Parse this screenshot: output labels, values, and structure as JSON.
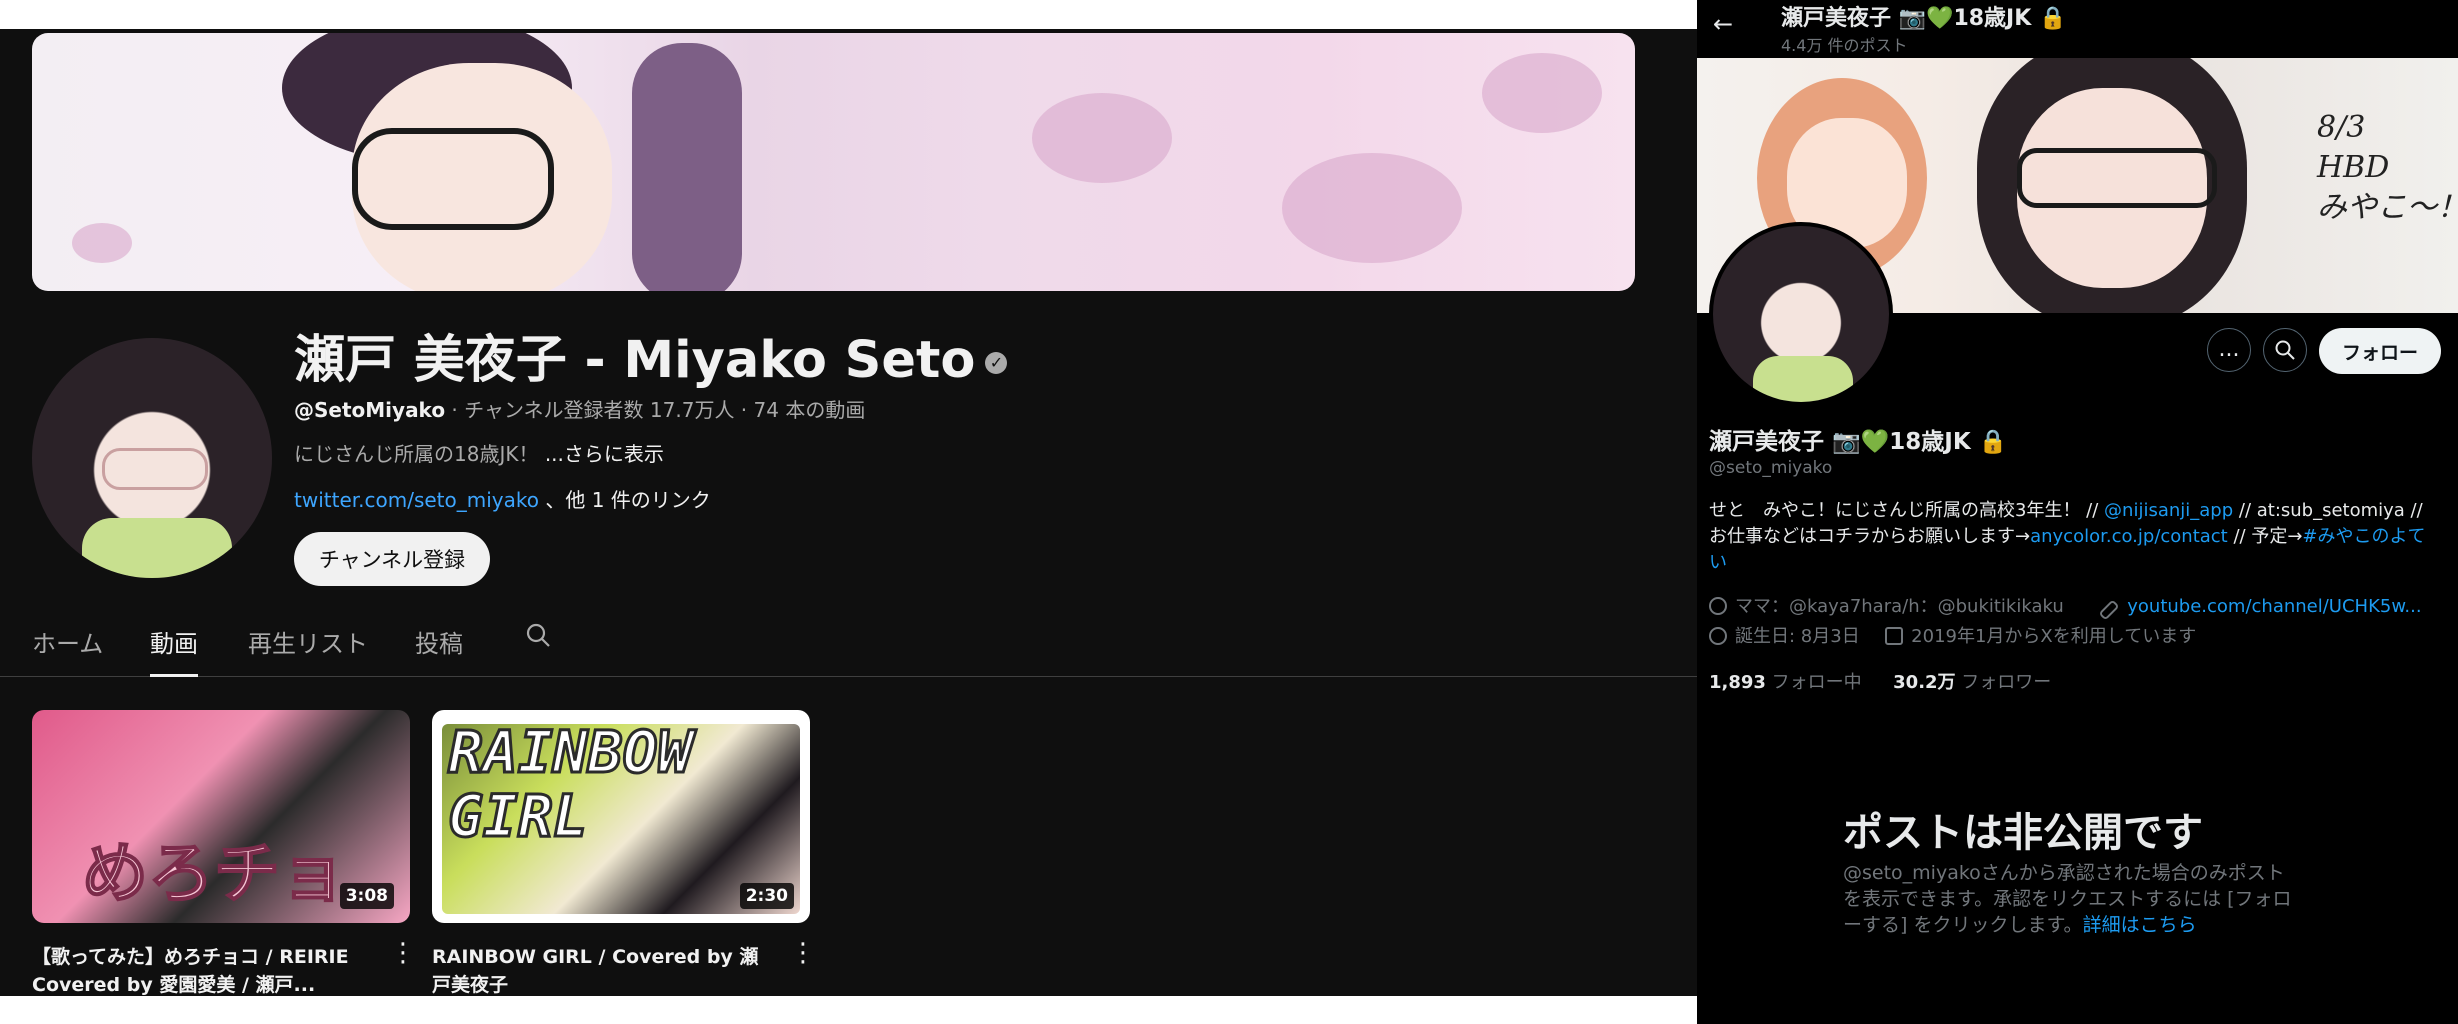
{
  "youtube": {
    "channel_name": "瀬戸 美夜子 - Miyako Seto",
    "handle": "@SetoMiyako",
    "meta": " · チャンネル登録者数 17.7万人 · 74 本の動画",
    "description": "にじさんじ所属の18歳JK！ ",
    "description_more": "...さらに表示",
    "link_url": "twitter.com/seto_miyako",
    "link_suffix": " 、他 1 件のリンク",
    "subscribe_label": "チャンネル登録",
    "tabs": [
      "ホーム",
      "動画",
      "再生リスト",
      "投稿"
    ],
    "active_tab": "動画",
    "videos": [
      {
        "title": "【歌ってみた】めろチョコ / REIRIE Covered by 愛園愛美 / 瀬戸...",
        "duration": "3:08",
        "thumb_text": "めろチョコ"
      },
      {
        "title": "RAINBOW GIRL / Covered by 瀬戸美夜子",
        "duration": "2:30",
        "thumb_text": "RAINBOW\nGIRL"
      }
    ]
  },
  "x": {
    "header_title": "瀬戸美夜子 📷💚18歳JK 🔒",
    "header_sub": "4.4万 件のポスト",
    "banner_note": "8/3\nHBD\nみやこ〜！",
    "more_icon": "...",
    "follow_label": "フォロー",
    "name": "瀬戸美夜子 📷💚18歳JK 🔒",
    "handle": "@seto_miyako",
    "bio_1": "せと　みやこ！にじさんじ所属の高校3年生！ // ",
    "bio_link1": "@nijisanji_app",
    "bio_2": " // at:sub_setomiya // お仕事などはコチラからお願いします→",
    "bio_link2": "anycolor.co.jp/contact",
    "bio_3": " // 予定→",
    "bio_link3": "#みやこのよてい",
    "mama": "ママ：@kaya7hara/h：@bukitikikaku",
    "website": "youtube.com/channel/UCHK5w...",
    "birthday": "誕生日: 8月3日",
    "joined": "2019年1月からXを利用しています",
    "following_count": "1,893",
    "following_label": " フォロー中",
    "followers_count": "30.2万",
    "followers_label": " フォロワー",
    "private_title": "ポストは非公開です",
    "private_body": "@seto_miyakoさんから承認された場合のみポストを表示できます。承認をリクエストするには [フォローする] をクリックします。",
    "private_link": "詳細はこちら"
  }
}
